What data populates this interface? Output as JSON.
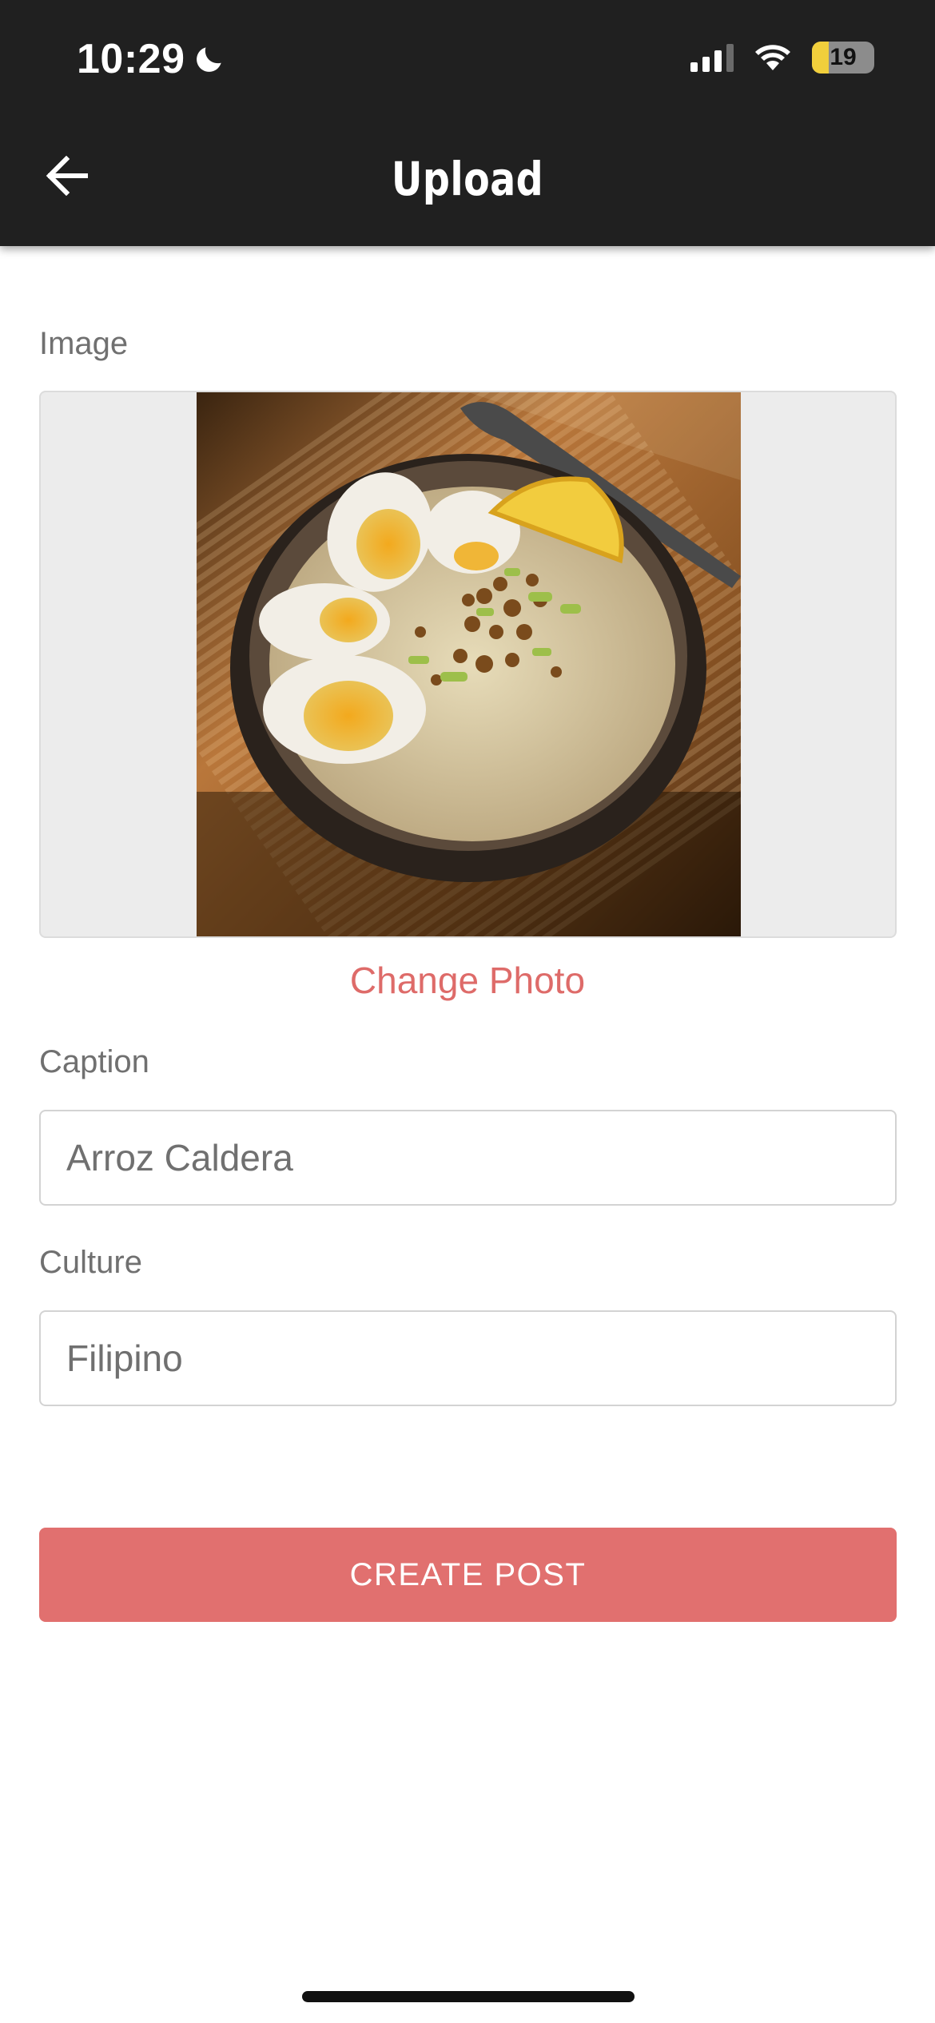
{
  "status_bar": {
    "time": "10:29",
    "battery": "19",
    "icons": [
      "moon-icon",
      "cellular-signal-icon",
      "wifi-icon",
      "battery-icon"
    ]
  },
  "header": {
    "title": "Upload",
    "back_icon": "arrow-left-icon"
  },
  "form": {
    "image_label": "Image",
    "change_photo": "Change Photo",
    "caption_label": "Caption",
    "caption_value": "Arroz Caldera",
    "culture_label": "Culture",
    "culture_value": "Filipino",
    "submit_label": "CREATE POST"
  },
  "colors": {
    "header_bg": "#202020",
    "accent": "#e1706f",
    "link": "#de6b69",
    "label_text": "#707070"
  }
}
